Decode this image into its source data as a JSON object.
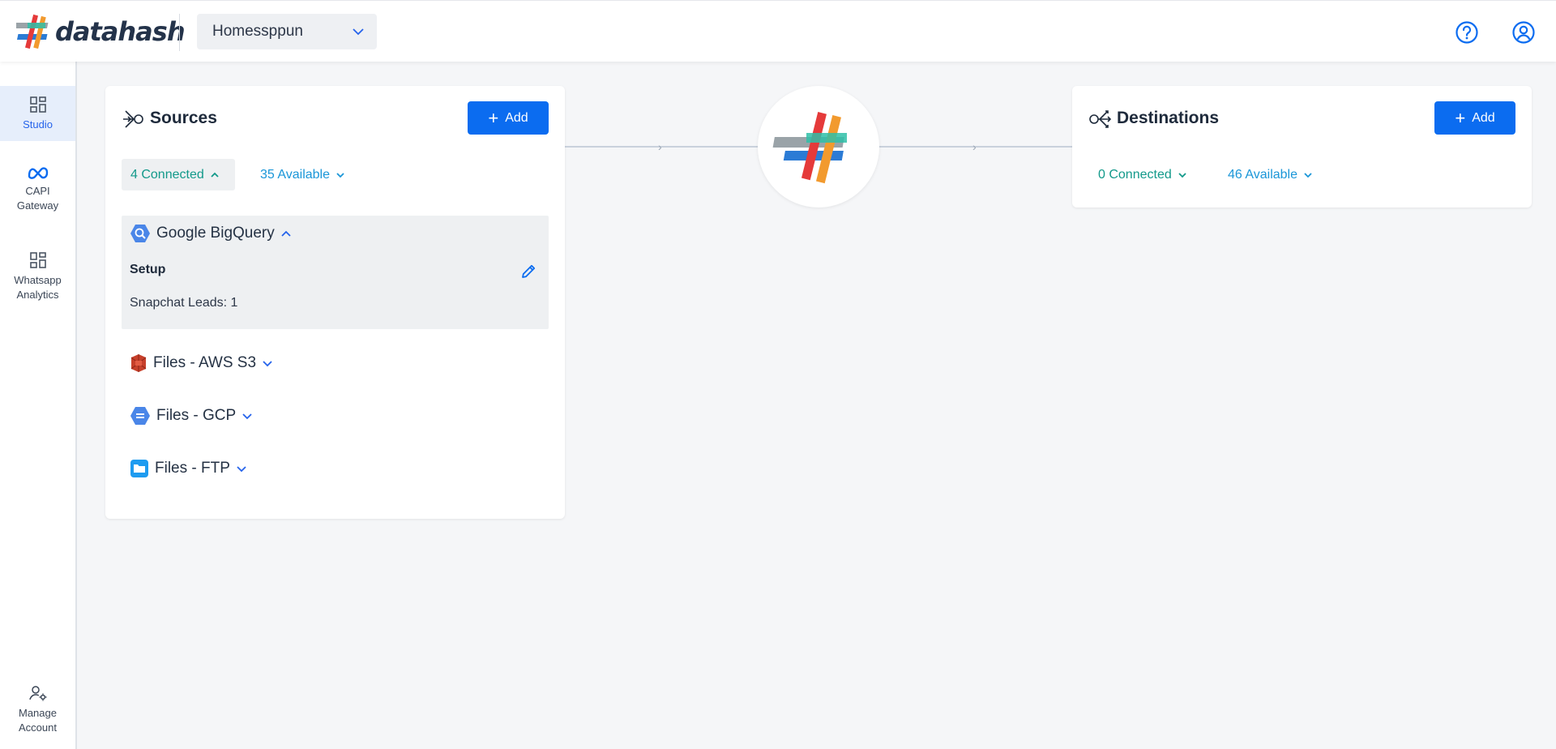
{
  "header": {
    "logo_text": "datahash",
    "workspace": "Homessppun"
  },
  "sidebar": {
    "items": [
      {
        "label": "Studio"
      },
      {
        "label": "CAPI Gateway"
      },
      {
        "label": "Whatsapp Analytics"
      },
      {
        "label": "Manage Account"
      }
    ]
  },
  "sources": {
    "title": "Sources",
    "add_label": "Add",
    "connected_label": "4 Connected",
    "available_label": "35 Available",
    "expanded": {
      "name": "Google BigQuery",
      "setup_label": "Setup",
      "detail": "Snapchat Leads: 1"
    },
    "items": [
      {
        "name": "Files - AWS S3"
      },
      {
        "name": "Files - GCP"
      },
      {
        "name": "Files - FTP"
      }
    ]
  },
  "destinations": {
    "title": "Destinations",
    "add_label": "Add",
    "connected_label": "0 Connected",
    "available_label": "46 Available"
  },
  "colors": {
    "accent": "#0b6cf0",
    "connected": "#12998a",
    "available": "#1a96d8",
    "active_nav_bg": "#e6eefb"
  }
}
